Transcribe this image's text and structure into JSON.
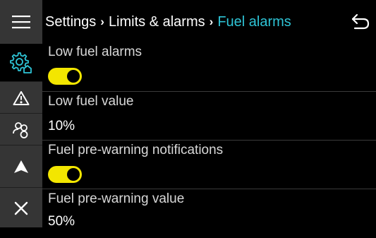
{
  "colors": {
    "accent": "#2ec4d6",
    "toggle_on": "#f3e600",
    "sidebar_bg": "#353535",
    "background": "#000000"
  },
  "header": {
    "breadcrumb": [
      "Settings",
      "Limits & alarms",
      "Fuel alarms"
    ],
    "separator": "›"
  },
  "sidebar": {
    "items": [
      {
        "icon": "menu-icon"
      },
      {
        "icon": "settings-icon",
        "active": true
      },
      {
        "icon": "warning-icon"
      },
      {
        "icon": "people-icon"
      },
      {
        "icon": "navigation-icon"
      },
      {
        "icon": "close-icon"
      }
    ]
  },
  "settings": [
    {
      "label": "Low fuel alarms",
      "type": "toggle",
      "on": true
    },
    {
      "label": "Low fuel value",
      "type": "value",
      "value": "10%"
    },
    {
      "label": "Fuel pre-warning notifications",
      "type": "toggle",
      "on": true
    },
    {
      "label": "Fuel pre-warning value",
      "type": "value",
      "value": "50%"
    }
  ]
}
